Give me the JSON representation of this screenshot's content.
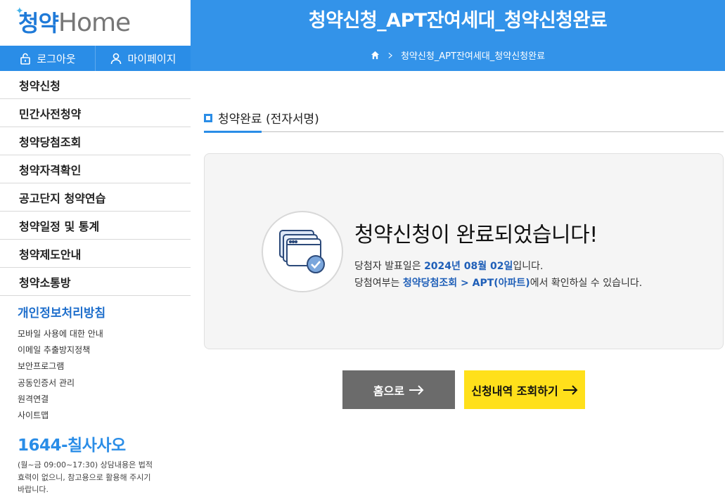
{
  "logo": {
    "part_a": "청약",
    "part_b": "Home"
  },
  "userbar": {
    "logout": "로그아웃",
    "mypage": "마이페이지"
  },
  "menu": [
    "청약신청",
    "민간사전청약",
    "청약당첨조회",
    "청약자격확인",
    "공고단지 청약연습",
    "청약일정 및 통계",
    "청약제도안내",
    "청약소통방"
  ],
  "policy": {
    "title": "개인정보처리방침",
    "links": [
      "모바일 사용에 대한 안내",
      "이메일 추출방지정책",
      "보안프로그램",
      "공동인증서 관리",
      "원격연결",
      "사이트맵"
    ]
  },
  "callcenter": {
    "number": "1644-칠사사오",
    "note": "(월~금 09:00~17:30) 상담내용은 법적효력이 없으니, 참고용으로 활용해 주시기 바랍니다."
  },
  "header": {
    "title": "청약신청_APT잔여세대_청약신청완료",
    "breadcrumb": "청약신청_APT잔여세대_청약신청완료"
  },
  "section": {
    "title": "청약완료 (전자서명)"
  },
  "result": {
    "title": "청약신청이 완료되었습니다!",
    "line1_pre": "당첨자 발표일은 ",
    "line1_date": "2024년 08월 02일",
    "line1_post": "입니다.",
    "line2_pre": "당첨여부는 ",
    "line2_link": "청약당첨조회 > APT(아파트)",
    "line2_post": "에서 확인하실 수 있습니다."
  },
  "buttons": {
    "home": "홈으로",
    "view": "신청내역 조회하기"
  },
  "colors": {
    "primary": "#3393e9",
    "accent_yellow": "#ffe01b",
    "gray_button": "#6b6b6b",
    "link_blue": "#1f5fb8"
  },
  "icons": [
    "lock-icon",
    "user-icon",
    "home-icon",
    "chevron-right-icon",
    "document-check-icon",
    "arrow-right-icon"
  ]
}
